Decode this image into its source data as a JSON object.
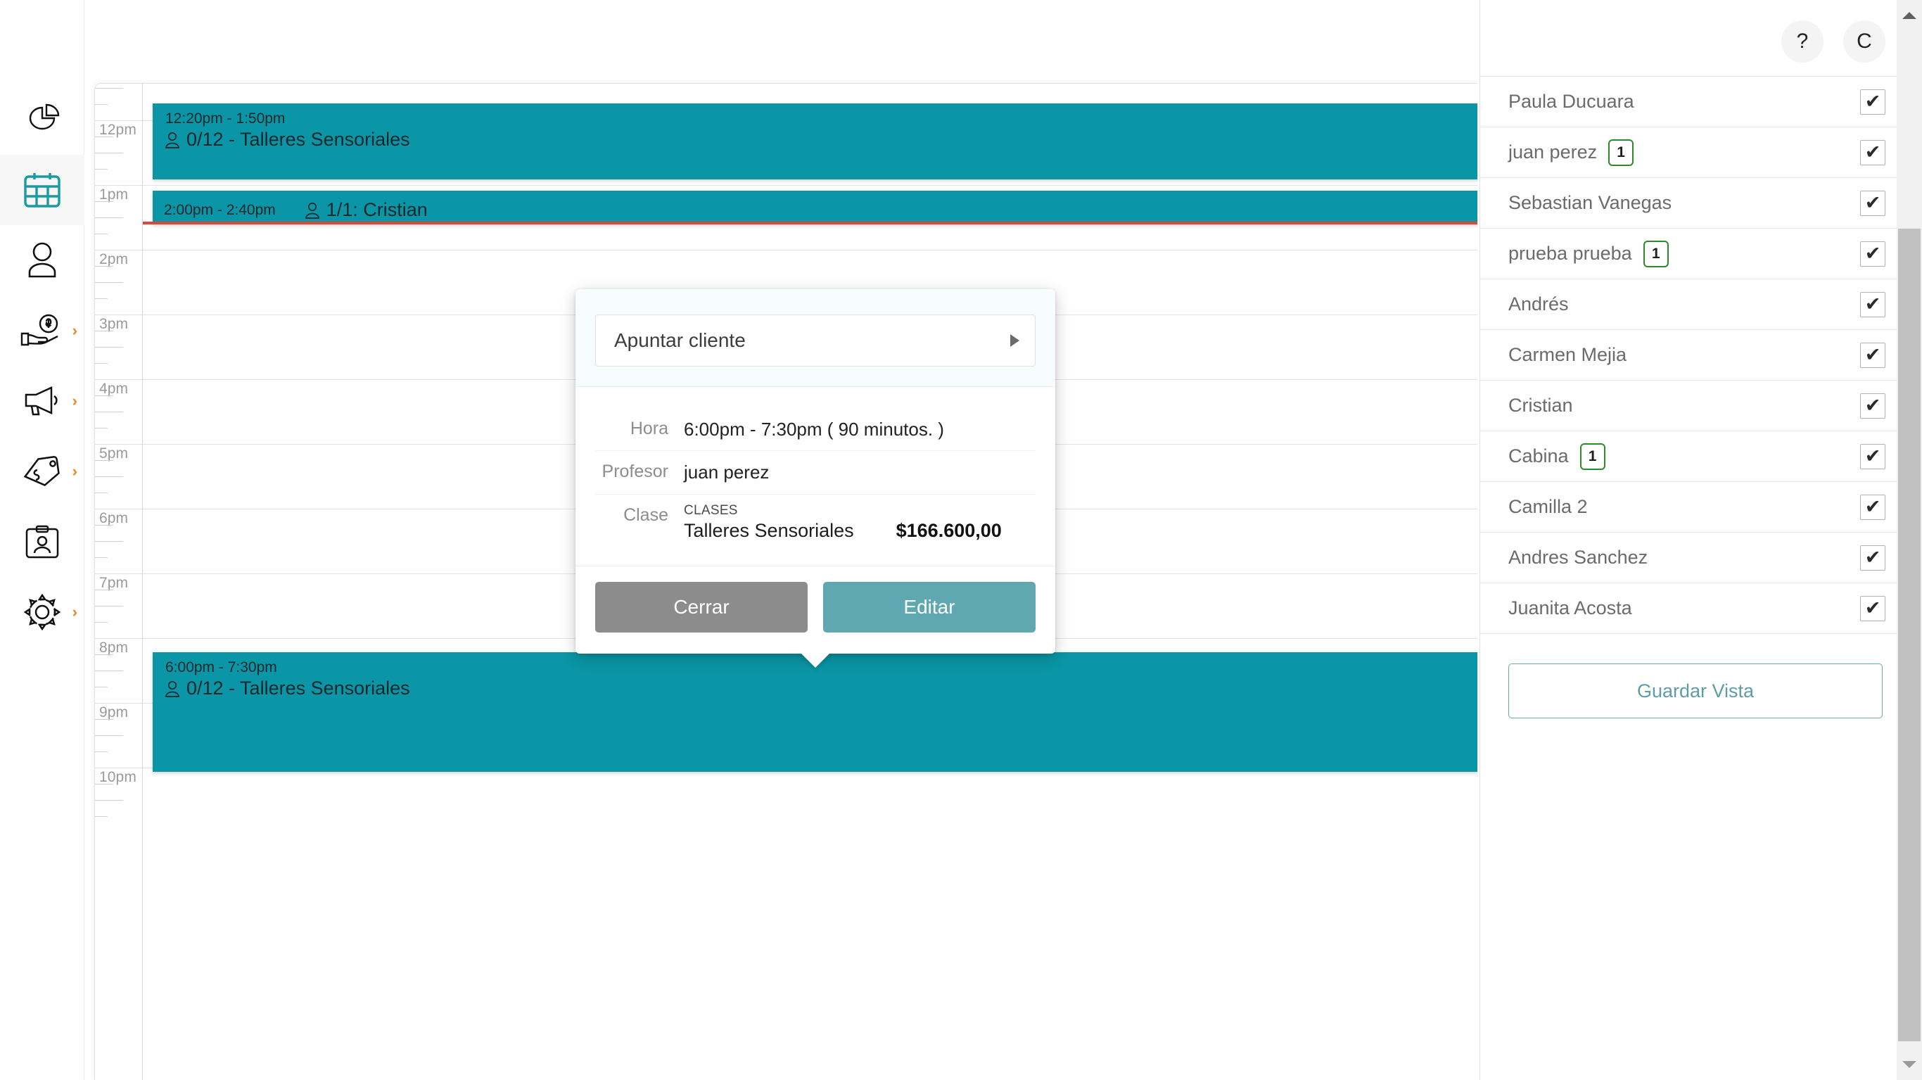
{
  "topbar": {
    "help_label": "?",
    "account_label": "C"
  },
  "nav": {
    "items": [
      {
        "name": "reports",
        "icon": "pie-chart-icon",
        "active": false,
        "caret": false
      },
      {
        "name": "calendar",
        "icon": "calendar-icon",
        "active": true,
        "caret": false
      },
      {
        "name": "clients",
        "icon": "user-icon",
        "active": false,
        "caret": false
      },
      {
        "name": "sales",
        "icon": "hand-money-icon",
        "active": false,
        "caret": true
      },
      {
        "name": "marketing",
        "icon": "megaphone-icon",
        "active": false,
        "caret": true
      },
      {
        "name": "products",
        "icon": "price-tag-icon",
        "active": false,
        "caret": true
      },
      {
        "name": "staff",
        "icon": "id-badge-icon",
        "active": false,
        "caret": false
      },
      {
        "name": "settings",
        "icon": "gear-icon",
        "active": false,
        "caret": true
      }
    ],
    "caret_glyph": "›"
  },
  "calendar": {
    "hours": [
      "12pm",
      "1pm",
      "2pm",
      "3pm",
      "4pm",
      "5pm",
      "6pm",
      "7pm",
      "8pm",
      "9pm",
      "10pm"
    ],
    "now_line_visible": true,
    "events": [
      {
        "time": "12:20pm - 1:50pm",
        "detail": "0/12 - Talleres Sensoriales",
        "layout": "stacked",
        "icon": "person-icon",
        "color": "#0a96a6"
      },
      {
        "time": "2:00pm - 2:40pm",
        "detail": "1/1: Cristian",
        "layout": "inline",
        "icon": "person-icon",
        "color": "#0a96a6"
      },
      {
        "time": "6:00pm - 7:30pm",
        "detail": "0/12 - Talleres Sensoriales",
        "layout": "stacked",
        "icon": "person-icon",
        "color": "#0a96a6"
      }
    ]
  },
  "popup": {
    "select_label": "Apuntar cliente",
    "select_caret_icon": "caret-right-icon",
    "rows": [
      {
        "key": "Hora",
        "value": "6:00pm - 7:30pm ( 90 minutos. )"
      },
      {
        "key": "Profesor",
        "value": "juan perez"
      }
    ],
    "clase": {
      "key": "Clase",
      "category": "CLASES",
      "name": "Talleres Sensoriales",
      "price": "$166.600,00"
    },
    "buttons": {
      "close_label": "Cerrar",
      "edit_label": "Editar"
    }
  },
  "right_panel": {
    "items": [
      {
        "name": "Paula Ducuara",
        "badge": null,
        "checked": true
      },
      {
        "name": "juan perez",
        "badge": "1",
        "checked": true
      },
      {
        "name": "Sebastian Vanegas",
        "badge": null,
        "checked": true
      },
      {
        "name": "prueba prueba",
        "badge": "1",
        "checked": true
      },
      {
        "name": "Andrés",
        "badge": null,
        "checked": true
      },
      {
        "name": "Carmen Mejia",
        "badge": null,
        "checked": true
      },
      {
        "name": "Cristian",
        "badge": null,
        "checked": true
      },
      {
        "name": "Cabina",
        "badge": "1",
        "checked": true
      },
      {
        "name": "Camilla 2",
        "badge": null,
        "checked": true
      },
      {
        "name": "Andres Sanchez",
        "badge": null,
        "checked": true
      },
      {
        "name": "Juanita Acosta",
        "badge": null,
        "checked": true
      }
    ],
    "check_glyph": "✔",
    "save_label": "Guardar Vista"
  },
  "colors": {
    "event_teal": "#0a96a6",
    "accent_teal": "#1a9aa5",
    "now_red": "#d9483b",
    "edit_button": "#5fa8b2",
    "close_button": "#8c8c8c",
    "badge_green": "#2b8a2b"
  }
}
